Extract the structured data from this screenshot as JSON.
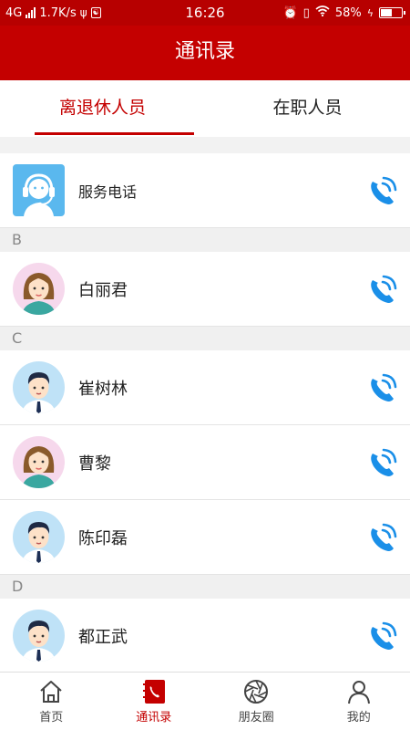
{
  "status_bar": {
    "network": "4G",
    "speed": "1.7K/s",
    "time": "16:26",
    "battery_pct_label": "58%",
    "battery_level": 0.58
  },
  "header": {
    "title": "通讯录"
  },
  "tabs": [
    {
      "label": "离退休人员",
      "active": true
    },
    {
      "label": "在职人员",
      "active": false
    }
  ],
  "service": {
    "label": "服务电话"
  },
  "sections": [
    {
      "letter": "B",
      "contacts": [
        {
          "name": "白丽君",
          "avatar": "female-avatar-icon"
        }
      ]
    },
    {
      "letter": "C",
      "contacts": [
        {
          "name": "崔树林",
          "avatar": "male-avatar-icon"
        },
        {
          "name": "曹黎",
          "avatar": "female-avatar-icon"
        },
        {
          "name": "陈印磊",
          "avatar": "male-avatar-icon"
        }
      ]
    },
    {
      "letter": "D",
      "contacts": [
        {
          "name": "都正武",
          "avatar": "male-avatar-icon"
        }
      ]
    }
  ],
  "bottom_nav": [
    {
      "label": "首页",
      "icon": "home-icon",
      "active": false
    },
    {
      "label": "通讯录",
      "icon": "contacts-icon",
      "active": true
    },
    {
      "label": "朋友圈",
      "icon": "aperture-icon",
      "active": false
    },
    {
      "label": "我的",
      "icon": "user-icon",
      "active": false
    }
  ],
  "colors": {
    "brand_red": "#c40000",
    "status_red": "#b70000",
    "phone_blue": "#1a8fe8"
  }
}
